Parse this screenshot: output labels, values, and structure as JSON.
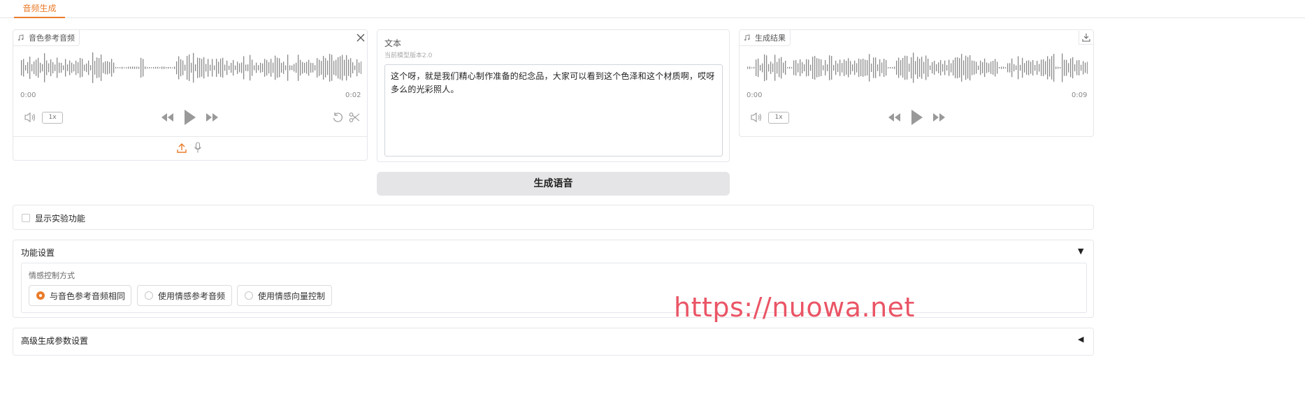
{
  "tabs": [
    {
      "label": "音频生成"
    }
  ],
  "ref_audio": {
    "label": "音色参考音频",
    "time_start": "0:00",
    "time_end": "0:02",
    "rate": "1x"
  },
  "text_input": {
    "label": "文本",
    "model_info": "当前模型版本2.0",
    "value": "这个呀，就是我们精心制作准备的纪念品，大家可以看到这个色泽和这个材质啊，哎呀多么的光彩照人。"
  },
  "result_audio": {
    "label": "生成结果",
    "time_start": "0:00",
    "time_end": "0:09",
    "rate": "1x"
  },
  "generate_button": "生成语音",
  "experimental": {
    "label": "显示实验功能",
    "checked": false
  },
  "function_settings": {
    "title": "功能设置",
    "toggle": "▼",
    "emotion_group": {
      "label": "情感控制方式",
      "options": [
        {
          "label": "与音色参考音频相同",
          "selected": true
        },
        {
          "label": "使用情感参考音频",
          "selected": false
        },
        {
          "label": "使用情感向量控制",
          "selected": false
        }
      ]
    }
  },
  "advanced_settings": {
    "title": "高级生成参数设置",
    "toggle": "◀"
  },
  "watermark": "https://nuowa.net",
  "colors": {
    "accent": "#ea7c2a",
    "watermark": "#ea5566",
    "wave": "#8a8a8a"
  }
}
